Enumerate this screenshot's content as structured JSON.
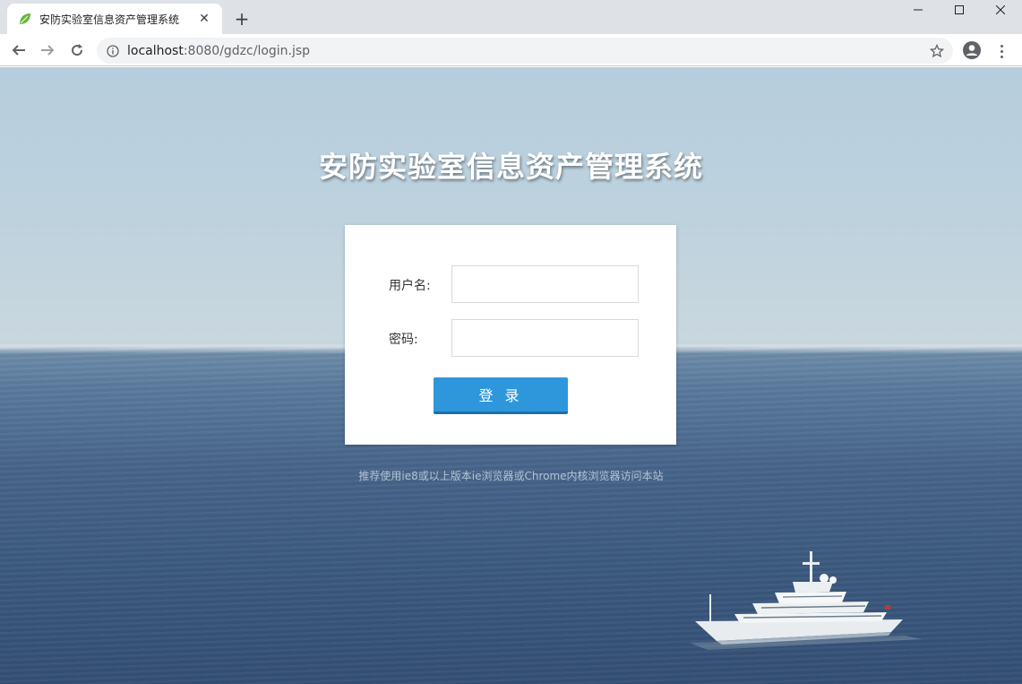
{
  "browser": {
    "tab_title": "安防实验室信息资产管理系统",
    "url_host": "localhost",
    "url_rest": ":8080/gdzc/login.jsp"
  },
  "page": {
    "title": "安防实验室信息资产管理系统",
    "login": {
      "username_label": "用户名:",
      "password_label": "密码:",
      "username_value": "",
      "password_value": "",
      "submit_label": "登 录"
    },
    "hint": "推荐使用ie8或以上版本ie浏览器或Chrome内核浏览器访问本站"
  },
  "colors": {
    "button": "#2e97dc",
    "title": "#ffffff"
  },
  "icons": [
    "leaf-favicon-icon",
    "close-icon",
    "plus-icon",
    "minimize-icon",
    "maximize-icon",
    "window-close-icon",
    "back-arrow-icon",
    "forward-arrow-icon",
    "reload-icon",
    "info-icon",
    "star-icon",
    "account-icon",
    "menu-dots-icon"
  ]
}
